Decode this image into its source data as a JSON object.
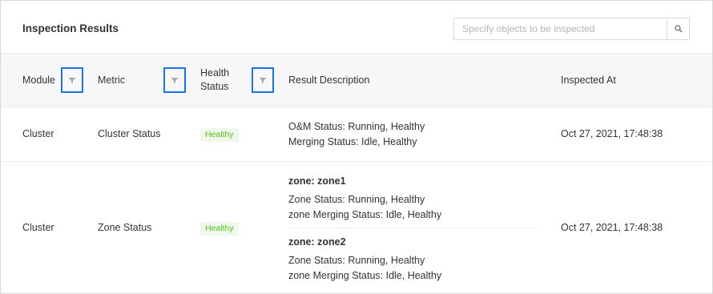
{
  "header": {
    "title": "Inspection Results",
    "search_placeholder": "Specify objects to be inspected"
  },
  "columns": {
    "module": "Module",
    "metric": "Metric",
    "health_line1": "Health",
    "health_line2": "Status",
    "description": "Result Description",
    "inspected_at": "Inspected At"
  },
  "rows": [
    {
      "module": "Cluster",
      "metric": "Cluster Status",
      "health": "Healthy",
      "description": [
        "O&M Status: Running, Healthy",
        "Merging Status: Idle, Healthy"
      ],
      "inspected_at": "Oct 27, 2021, 17:48:38"
    },
    {
      "module": "Cluster",
      "metric": "Zone Status",
      "health": "Healthy",
      "zones": [
        {
          "title": "zone: zone1",
          "lines": [
            "Zone Status: Running, Healthy",
            "zone Merging Status: Idle, Healthy"
          ]
        },
        {
          "title": "zone: zone2",
          "lines": [
            "Zone Status: Running, Healthy",
            "zone Merging Status: Idle, Healthy"
          ]
        }
      ],
      "inspected_at": "Oct 27, 2021, 17:48:38"
    }
  ],
  "colors": {
    "accent_border": "#1a73e8",
    "healthy_text": "#52c41a",
    "healthy_bg": "#f0f8eb",
    "header_bg": "#f7f7f8"
  }
}
